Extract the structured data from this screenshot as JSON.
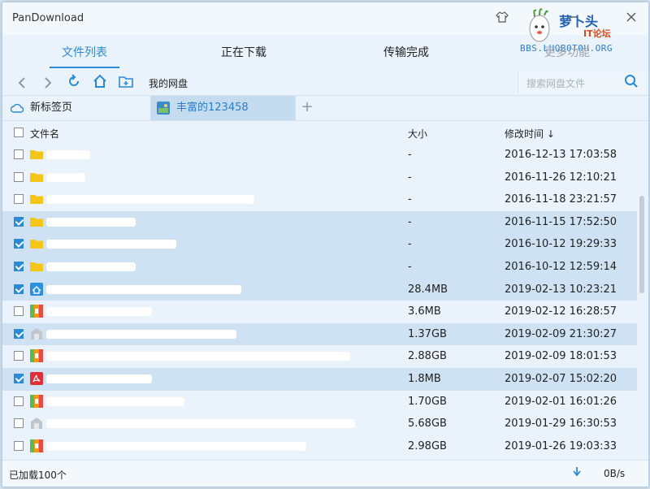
{
  "window": {
    "title": "PanDownload"
  },
  "watermark": {
    "name_cn": "萝卜头",
    "sub": "IT论坛",
    "url": "BBS.LUOBOTOU.ORG"
  },
  "tabs": [
    {
      "label": "文件列表"
    },
    {
      "label": "正在下载"
    },
    {
      "label": "传输完成"
    },
    {
      "label": "更多功能"
    }
  ],
  "toolbar": {
    "path": "我的网盘",
    "search_placeholder": "搜索网盘文件"
  },
  "file_tabs": {
    "new_tab": "新标签页",
    "active_tab": "丰富的123458"
  },
  "columns": {
    "name": "文件名",
    "size": "大小",
    "time": "修改时间 ↓"
  },
  "files": [
    {
      "checked": false,
      "icon": "folder-icon",
      "size": "-",
      "time": "2016-12-13 17:03:58"
    },
    {
      "checked": false,
      "icon": "folder-icon",
      "size": "-",
      "time": "2016-11-26 12:10:21"
    },
    {
      "checked": false,
      "icon": "folder-icon",
      "size": "-",
      "time": "2016-11-18 23:21:57"
    },
    {
      "checked": true,
      "icon": "folder-icon",
      "size": "-",
      "time": "2016-11-15 17:52:50"
    },
    {
      "checked": true,
      "icon": "folder-icon",
      "size": "-",
      "time": "2016-10-12 19:29:33"
    },
    {
      "checked": true,
      "icon": "folder-icon",
      "size": "-",
      "time": "2016-10-12 12:59:14"
    },
    {
      "checked": true,
      "icon": "installer-icon",
      "size": "28.4MB",
      "time": "2019-02-13 10:23:21"
    },
    {
      "checked": false,
      "icon": "archive-icon",
      "size": "3.6MB",
      "time": "2019-02-12 16:28:57"
    },
    {
      "checked": true,
      "icon": "package-icon",
      "size": "1.37GB",
      "time": "2019-02-09 21:30:27"
    },
    {
      "checked": false,
      "icon": "archive-icon",
      "size": "2.88GB",
      "time": "2019-02-09 18:01:53"
    },
    {
      "checked": true,
      "icon": "pdf-icon",
      "size": "1.8MB",
      "time": "2019-02-07 15:02:20"
    },
    {
      "checked": false,
      "icon": "archive-icon",
      "size": "1.70GB",
      "time": "2019-02-01 16:01:26"
    },
    {
      "checked": false,
      "icon": "package-icon",
      "size": "5.68GB",
      "time": "2019-01-29 16:30:53"
    },
    {
      "checked": false,
      "icon": "archive-icon",
      "size": "2.98GB",
      "time": "2019-01-26 19:03:33"
    }
  ],
  "status": {
    "loaded": "已加载100个",
    "speed": "0B/s"
  }
}
